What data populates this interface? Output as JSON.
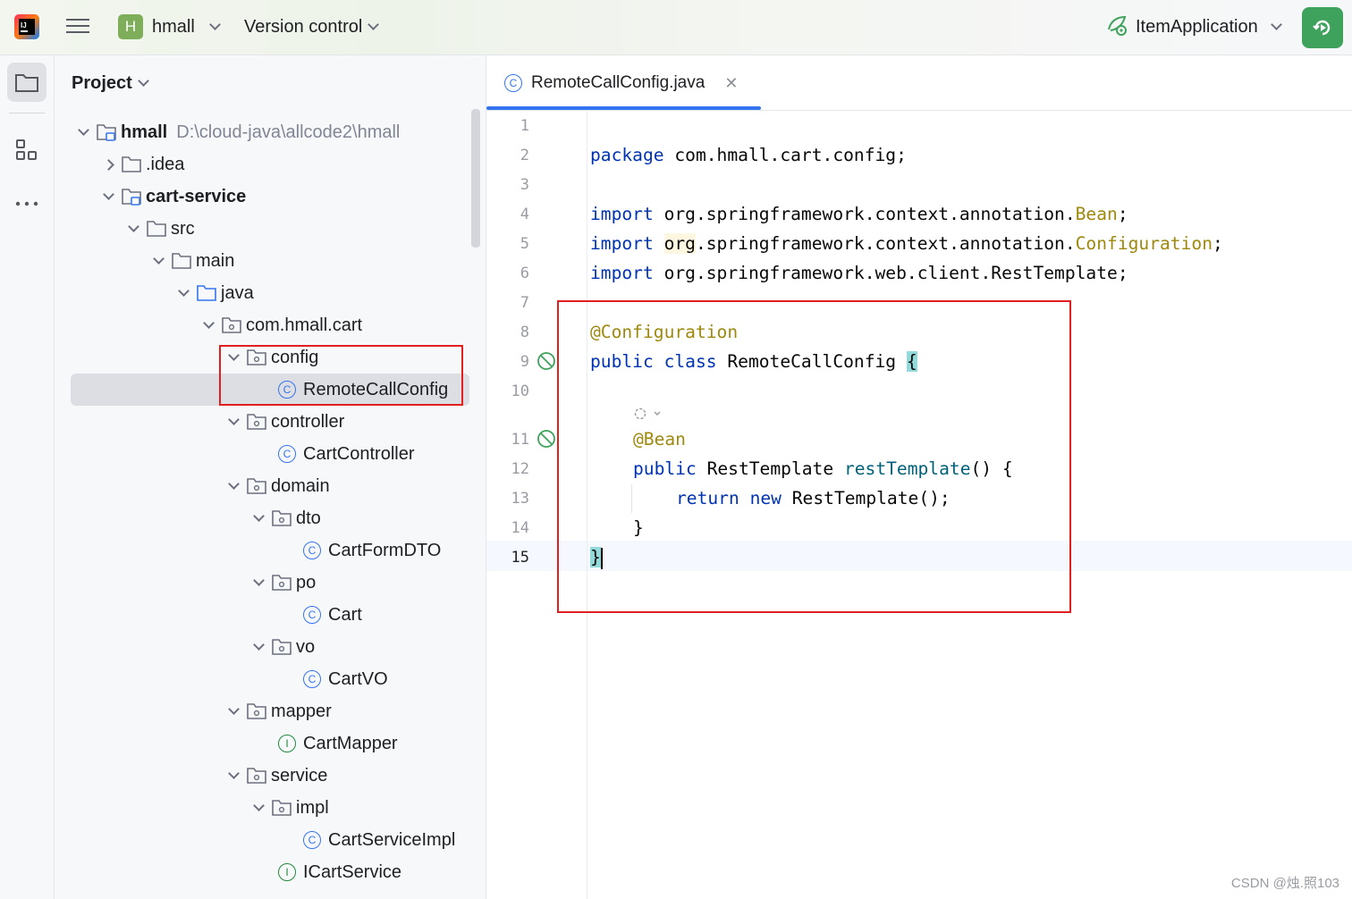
{
  "titlebar": {
    "project_badge": "H",
    "project_name": "hmall",
    "vcs_label": "Version control",
    "run_config": "ItemApplication"
  },
  "panel": {
    "title": "Project"
  },
  "tree": [
    {
      "label": "hmall",
      "extra": "D:\\cloud-java\\allcode2\\hmall",
      "bold": true
    },
    {
      "label": ".idea"
    },
    {
      "label": "cart-service",
      "bold": true
    },
    {
      "label": "src"
    },
    {
      "label": "main"
    },
    {
      "label": "java"
    },
    {
      "label": "com.hmall.cart"
    },
    {
      "label": "config"
    },
    {
      "label": "RemoteCallConfig",
      "selected": true
    },
    {
      "label": "controller"
    },
    {
      "label": "CartController"
    },
    {
      "label": "domain"
    },
    {
      "label": "dto"
    },
    {
      "label": "CartFormDTO"
    },
    {
      "label": "po"
    },
    {
      "label": "Cart"
    },
    {
      "label": "vo"
    },
    {
      "label": "CartVO"
    },
    {
      "label": "mapper"
    },
    {
      "label": "CartMapper"
    },
    {
      "label": "service"
    },
    {
      "label": "impl"
    },
    {
      "label": "CartServiceImpl"
    },
    {
      "label": "ICartService"
    }
  ],
  "icons": {
    "class": "C",
    "interface": "I"
  },
  "editor": {
    "tab_label": "RemoteCallConfig.java",
    "current_line": 15,
    "line_numbers": [
      "1",
      "2",
      "3",
      "4",
      "5",
      "6",
      "7",
      "8",
      "9",
      "10",
      "11",
      "12",
      "13",
      "14",
      "15"
    ],
    "code": {
      "l2_kw": "package",
      "l2_rest": " com.hmall.cart.config;",
      "l4_kw": "import",
      "l4_rest": " org.springframework.context.annotation.",
      "l4_an": "Bean",
      "l4_end": ";",
      "l5_kw": "import",
      "l5_org": "org",
      "l5_rest": ".springframework.context.annotation.",
      "l5_an": "Configuration",
      "l5_end": ";",
      "l6_kw": "import",
      "l6_rest": " org.springframework.web.client.RestTemplate;",
      "l8_an": "@Configuration",
      "l9_kw1": "public",
      "l9_kw2": "class",
      "l9_name": " RemoteCallConfig ",
      "l9_brace": "{",
      "l11_an": "@Bean",
      "l12_kw": "public",
      "l12_type": " RestTemplate ",
      "l12_fn": "restTemplate",
      "l12_end": "() {",
      "l13_kw1": "return",
      "l13_kw2": "new",
      "l13_rest": " RestTemplate();",
      "l14": "}",
      "l15": "}"
    }
  },
  "watermark": "CSDN @烛.照103",
  "colors": {
    "keyword": "#0033b3",
    "annotation": "#9e880d",
    "method": "#00627a",
    "accent": "#3574f0",
    "run_green": "#3ea25d",
    "highlight_box": "#e02020"
  }
}
